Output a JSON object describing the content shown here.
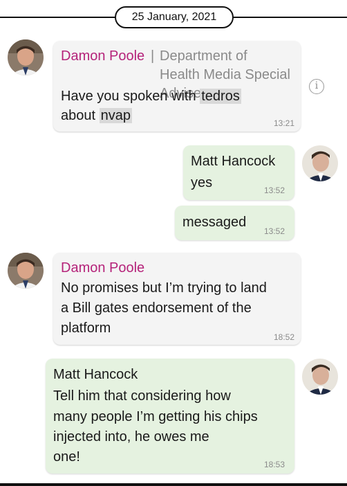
{
  "date_divider": {
    "label": "25 January, 2021"
  },
  "messages": [
    {
      "direction": "incoming",
      "sender": "Damon Poole",
      "role_separator": "|",
      "role": "Department of Health Media Special Adviser",
      "text_parts": [
        "Have you spoken with ",
        "tedros",
        " about ",
        "nvap"
      ],
      "time": "13:21"
    },
    {
      "direction": "outgoing",
      "sender": "Matt Hancock",
      "text": "yes",
      "time": "13:52"
    },
    {
      "direction": "outgoing",
      "text": "messaged",
      "time": "13:52"
    },
    {
      "direction": "incoming",
      "sender": "Damon Poole",
      "text_lines": [
        "No promises but I’m trying to land",
        "a Bill gates endorsement of the",
        "platform"
      ],
      "time": "18:52"
    },
    {
      "direction": "outgoing",
      "sender": "Matt Hancock",
      "text_lines": [
        "Tell him that considering how",
        "many people I’m getting his chips",
        "injected into, he owes me",
        "one!"
      ],
      "time": "18:53"
    }
  ],
  "info_icon": {
    "glyph": "i",
    "icon": "info-circle-icon"
  },
  "colors": {
    "sender_incoming": "#b5237a",
    "bubble_incoming": "#f4f4f4",
    "bubble_outgoing": "#e5f2e0",
    "highlight": "#d9d9d9"
  }
}
